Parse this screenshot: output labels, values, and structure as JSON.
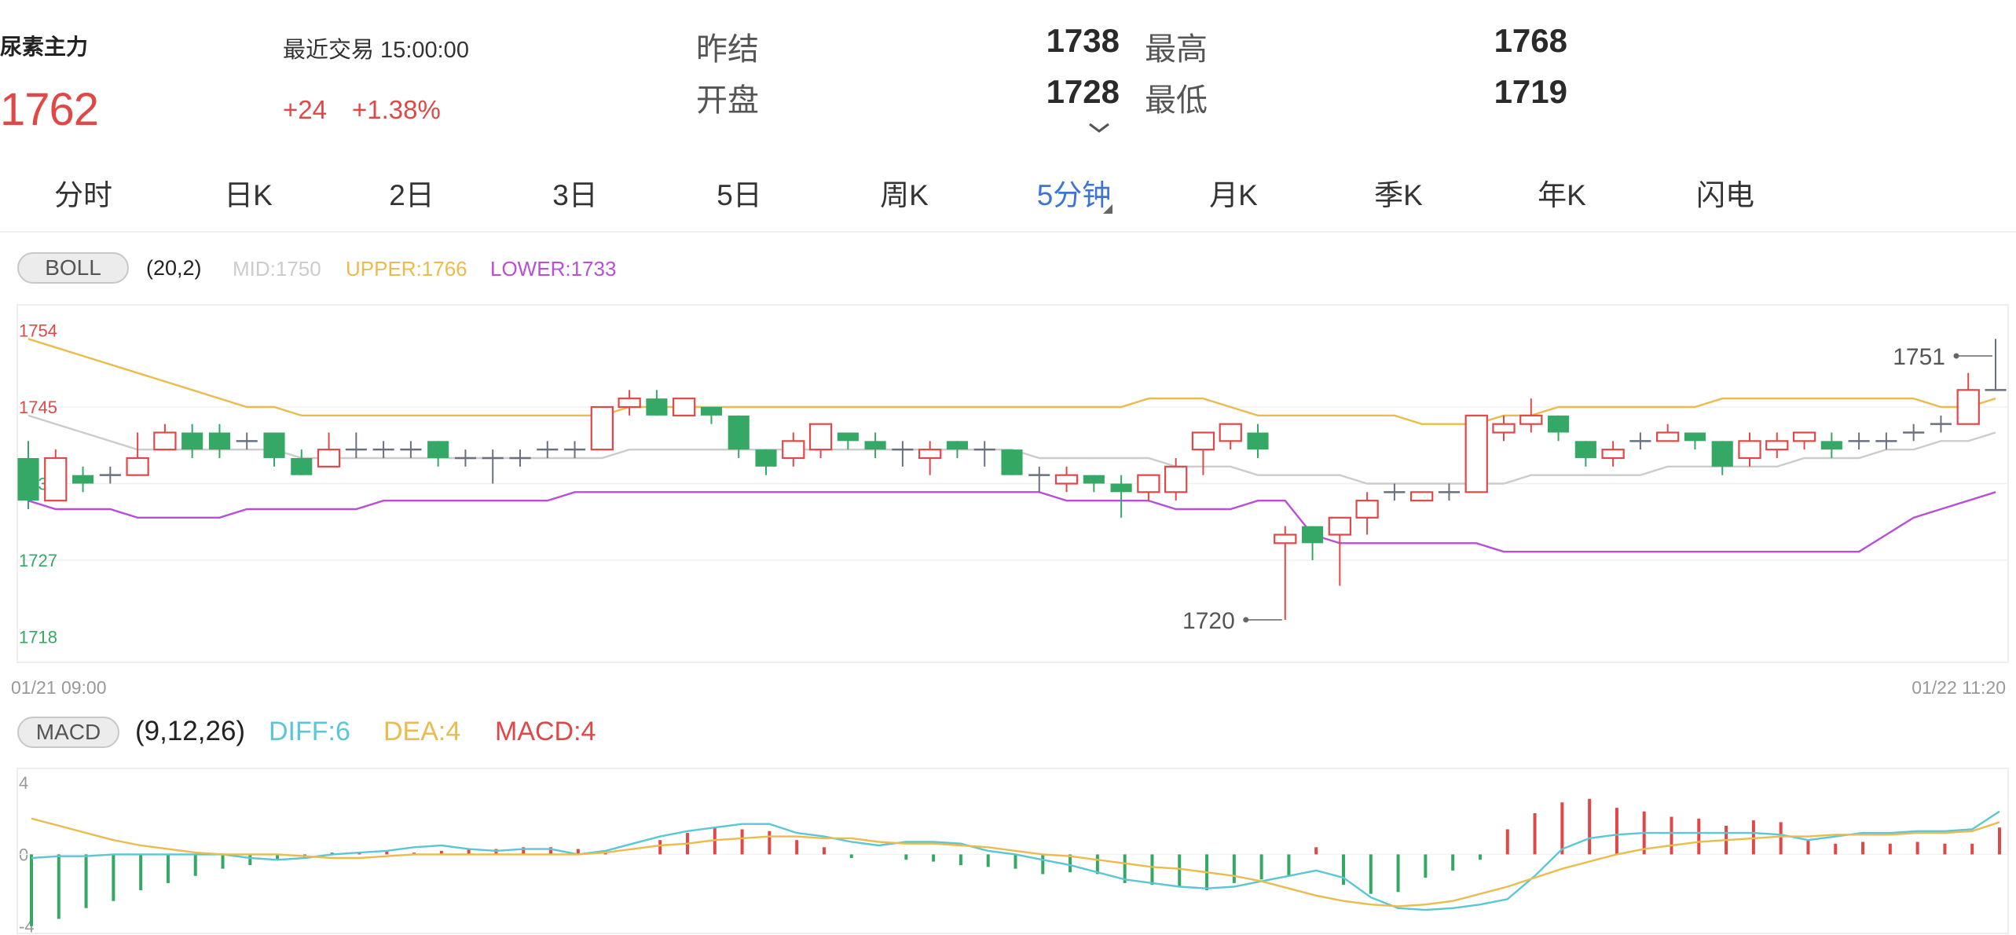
{
  "header": {
    "symbol_name": "尿素主力",
    "last_price": "1762",
    "last_trade_label": "最近交易 15:00:00",
    "change": "+24",
    "change_pct": "+1.38%",
    "stats": {
      "prev_settle_label": "昨结",
      "prev_settle_value": "1738",
      "high_label": "最高",
      "high_value": "1768",
      "open_label": "开盘",
      "open_value": "1728",
      "low_label": "最低",
      "low_value": "1719"
    }
  },
  "tabs": [
    {
      "label": "分时",
      "active": false
    },
    {
      "label": "日K",
      "active": false
    },
    {
      "label": "2日",
      "active": false
    },
    {
      "label": "3日",
      "active": false
    },
    {
      "label": "5日",
      "active": false
    },
    {
      "label": "周K",
      "active": false
    },
    {
      "label": "5分钟",
      "active": true
    },
    {
      "label": "月K",
      "active": false
    },
    {
      "label": "季K",
      "active": false
    },
    {
      "label": "年K",
      "active": false
    },
    {
      "label": "闪电",
      "active": false
    }
  ],
  "boll": {
    "name": "BOLL",
    "params": "(20,2)",
    "mid": "MID:1750",
    "upper": "UPPER:1766",
    "lower": "LOWER:1733"
  },
  "macd": {
    "name": "MACD",
    "params": "(9,12,26)",
    "diff": "DIFF:6",
    "dea": "DEA:4",
    "macd": "MACD:4"
  },
  "colors": {
    "up": "#e04848",
    "down": "#35a865",
    "flat": "#6a7080",
    "mid": "#cccccc",
    "upper": "#ebbb4e",
    "lower": "#b84fd8",
    "diff": "#5bc6d6",
    "dea": "#ebbb4e",
    "macd_label": "#e04848",
    "active_tab": "#3d74d6"
  },
  "chart_data": [
    {
      "type": "candlestick",
      "title": "BOLL",
      "y_ticks": [
        1754,
        1745,
        1736,
        1727,
        1718
      ],
      "ylim": [
        1715,
        1757
      ],
      "x_start_label": "01/21 09:00",
      "x_end_label": "01/22 11:20",
      "annotations": [
        {
          "text": "1751",
          "value": 1751
        },
        {
          "text": "1720",
          "value": 1720
        }
      ],
      "candles": [
        [
          1739,
          1734,
          1741,
          1733
        ],
        [
          1734,
          1739,
          1740,
          1734
        ],
        [
          1737,
          1736,
          1738,
          1735
        ],
        [
          1737,
          1737,
          1738,
          1736
        ],
        [
          1737,
          1739,
          1742,
          1737
        ],
        [
          1740,
          1742,
          1743,
          1740
        ],
        [
          1742,
          1740,
          1743,
          1739
        ],
        [
          1742,
          1740,
          1743,
          1739
        ],
        [
          1741,
          1741,
          1742,
          1740
        ],
        [
          1742,
          1739,
          1742,
          1738
        ],
        [
          1739,
          1737,
          1740,
          1737
        ],
        [
          1738,
          1740,
          1742,
          1738
        ],
        [
          1740,
          1740,
          1742,
          1739
        ],
        [
          1740,
          1740,
          1741,
          1739
        ],
        [
          1740,
          1740,
          1741,
          1739
        ],
        [
          1741,
          1739,
          1741,
          1738
        ],
        [
          1739,
          1739,
          1740,
          1738
        ],
        [
          1739,
          1739,
          1740,
          1736
        ],
        [
          1739,
          1739,
          1740,
          1738
        ],
        [
          1740,
          1740,
          1741,
          1739
        ],
        [
          1740,
          1740,
          1741,
          1739
        ],
        [
          1740,
          1745,
          1745,
          1740
        ],
        [
          1745,
          1746,
          1747,
          1744
        ],
        [
          1746,
          1744,
          1747,
          1744
        ],
        [
          1744,
          1746,
          1746,
          1744
        ],
        [
          1745,
          1744,
          1745,
          1743
        ],
        [
          1744,
          1740,
          1744,
          1739
        ],
        [
          1740,
          1738,
          1740,
          1737
        ],
        [
          1739,
          1741,
          1742,
          1738
        ],
        [
          1740,
          1743,
          1743,
          1739
        ],
        [
          1742,
          1741,
          1742,
          1740
        ],
        [
          1741,
          1740,
          1742,
          1739
        ],
        [
          1740,
          1740,
          1741,
          1738
        ],
        [
          1739,
          1740,
          1741,
          1737
        ],
        [
          1741,
          1740,
          1741,
          1739
        ],
        [
          1740,
          1740,
          1741,
          1738
        ],
        [
          1740,
          1737,
          1740,
          1737
        ],
        [
          1737,
          1737,
          1738,
          1735
        ],
        [
          1736,
          1737,
          1738,
          1735
        ],
        [
          1737,
          1736,
          1737,
          1735
        ],
        [
          1736,
          1735,
          1737,
          1732
        ],
        [
          1735,
          1737,
          1737,
          1734
        ],
        [
          1735,
          1738,
          1739,
          1734
        ],
        [
          1740,
          1742,
          1742,
          1737
        ],
        [
          1741,
          1743,
          1743,
          1740
        ],
        [
          1742,
          1740,
          1743,
          1739
        ],
        [
          1729,
          1730,
          1731,
          1720
        ],
        [
          1731,
          1729,
          1731,
          1727
        ],
        [
          1730,
          1732,
          1732,
          1724
        ],
        [
          1732,
          1734,
          1735,
          1730
        ],
        [
          1735,
          1735,
          1736,
          1734
        ],
        [
          1734,
          1735,
          1735,
          1734
        ],
        [
          1735,
          1735,
          1736,
          1734
        ],
        [
          1735,
          1744,
          1744,
          1735
        ],
        [
          1742,
          1743,
          1744,
          1741
        ],
        [
          1743,
          1744,
          1746,
          1742
        ],
        [
          1744,
          1742,
          1744,
          1741
        ],
        [
          1741,
          1739,
          1741,
          1738
        ],
        [
          1739,
          1740,
          1741,
          1738
        ],
        [
          1741,
          1741,
          1742,
          1740
        ],
        [
          1741,
          1742,
          1743,
          1741
        ],
        [
          1742,
          1741,
          1742,
          1740
        ],
        [
          1741,
          1738,
          1741,
          1737
        ],
        [
          1739,
          1741,
          1742,
          1738
        ],
        [
          1740,
          1741,
          1742,
          1739
        ],
        [
          1741,
          1742,
          1742,
          1740
        ],
        [
          1741,
          1740,
          1742,
          1739
        ],
        [
          1741,
          1741,
          1742,
          1740
        ],
        [
          1741,
          1741,
          1742,
          1740
        ],
        [
          1742,
          1742,
          1743,
          1741
        ],
        [
          1743,
          1743,
          1744,
          1742
        ],
        [
          1743,
          1747,
          1749,
          1743
        ],
        [
          1747,
          1747,
          1753,
          1747
        ]
      ],
      "series": [
        {
          "name": "MID",
          "values": [
            1744,
            1743,
            1742,
            1741,
            1740,
            1740,
            1740,
            1740,
            1740,
            1740,
            1739,
            1739,
            1739,
            1739,
            1739,
            1739,
            1739,
            1739,
            1739,
            1739,
            1739,
            1739,
            1740,
            1740,
            1740,
            1740,
            1740,
            1740,
            1740,
            1740,
            1740,
            1740,
            1740,
            1740,
            1740,
            1740,
            1740,
            1739,
            1739,
            1739,
            1739,
            1739,
            1738,
            1738,
            1738,
            1737,
            1737,
            1737,
            1737,
            1736,
            1736,
            1736,
            1736,
            1736,
            1736,
            1737,
            1737,
            1737,
            1737,
            1737,
            1738,
            1738,
            1738,
            1738,
            1738,
            1739,
            1739,
            1739,
            1740,
            1740,
            1741,
            1741,
            1742
          ]
        },
        {
          "name": "UPPER",
          "values": [
            1753,
            1752,
            1751,
            1750,
            1749,
            1748,
            1747,
            1746,
            1745,
            1745,
            1744,
            1744,
            1744,
            1744,
            1744,
            1744,
            1744,
            1744,
            1744,
            1744,
            1744,
            1744,
            1745,
            1745,
            1745,
            1745,
            1745,
            1745,
            1745,
            1745,
            1745,
            1745,
            1745,
            1745,
            1745,
            1745,
            1745,
            1745,
            1745,
            1745,
            1745,
            1746,
            1746,
            1746,
            1745,
            1744,
            1744,
            1744,
            1744,
            1744,
            1744,
            1743,
            1743,
            1743,
            1744,
            1744,
            1745,
            1745,
            1745,
            1745,
            1745,
            1745,
            1746,
            1746,
            1746,
            1746,
            1746,
            1746,
            1746,
            1746,
            1745,
            1745,
            1746
          ]
        },
        {
          "name": "LOWER",
          "values": [
            1734,
            1733,
            1733,
            1733,
            1732,
            1732,
            1732,
            1732,
            1733,
            1733,
            1733,
            1733,
            1733,
            1734,
            1734,
            1734,
            1734,
            1734,
            1734,
            1734,
            1735,
            1735,
            1735,
            1735,
            1735,
            1735,
            1735,
            1735,
            1735,
            1735,
            1735,
            1735,
            1735,
            1735,
            1735,
            1735,
            1735,
            1735,
            1734,
            1734,
            1734,
            1734,
            1733,
            1733,
            1733,
            1734,
            1734,
            1730,
            1729,
            1729,
            1729,
            1729,
            1729,
            1729,
            1728,
            1728,
            1728,
            1728,
            1728,
            1728,
            1728,
            1728,
            1728,
            1728,
            1728,
            1728,
            1728,
            1728,
            1730,
            1732,
            1733,
            1734,
            1735
          ]
        }
      ]
    },
    {
      "type": "bar",
      "title": "MACD",
      "y_ticks": [
        4,
        0,
        -4
      ],
      "ylim": [
        -4.5,
        4.8
      ],
      "series": [
        {
          "name": "MACD",
          "values": [
            -4,
            -3.6,
            -3.0,
            -2.6,
            -2.0,
            -1.6,
            -1.2,
            -0.8,
            -0.6,
            -0.3,
            -0.2,
            0.1,
            0.1,
            0.2,
            0.1,
            0.2,
            0.3,
            0.3,
            0.4,
            0.4,
            0.3,
            0.2,
            0,
            0.8,
            1.2,
            1.5,
            1.4,
            1.3,
            0.8,
            0.4,
            -0.2,
            0,
            -0.3,
            -0.4,
            -0.6,
            -0.7,
            -0.8,
            -1.1,
            -1.0,
            -1.1,
            -1.6,
            -1.7,
            -1.8,
            -2.0,
            -1.6,
            -1.4,
            -1.2,
            0.4,
            -1.7,
            -2.2,
            -2.1,
            -1.3,
            -0.9,
            -0.3,
            1.4,
            2.3,
            2.9,
            3.1,
            2.6,
            2.4,
            2.1,
            2.0,
            1.6,
            1.9,
            1.8,
            0.8,
            0.6,
            0.7,
            0.6,
            0.7,
            0.6,
            0.6,
            1.5
          ]
        },
        {
          "name": "DIFF",
          "values": [
            -0.2,
            -0.1,
            -0.1,
            0,
            0,
            0,
            0,
            0,
            -0.2,
            -0.3,
            -0.2,
            0,
            0.1,
            0.2,
            0.4,
            0.5,
            0.3,
            0.2,
            0.3,
            0.3,
            0,
            0.2,
            0.6,
            1,
            1.3,
            1.5,
            1.7,
            1.7,
            1.2,
            1.0,
            0.7,
            0.5,
            0.7,
            0.7,
            0.6,
            0.2,
            0,
            -0.3,
            -0.6,
            -1,
            -1.4,
            -1.6,
            -1.8,
            -1.9,
            -1.8,
            -1.5,
            -1.2,
            -0.9,
            -1.3,
            -2.4,
            -3.0,
            -3.1,
            -3.0,
            -2.8,
            -2.5,
            -1.2,
            0.3,
            0.9,
            1.1,
            1.2,
            1.2,
            1.2,
            1.2,
            1.2,
            1.1,
            0.8,
            1.0,
            1.2,
            1.2,
            1.3,
            1.3,
            1.4,
            2.4
          ]
        },
        {
          "name": "DEA",
          "values": [
            2.0,
            1.6,
            1.2,
            0.8,
            0.5,
            0.3,
            0.1,
            0,
            0,
            0,
            -0.1,
            -0.2,
            -0.2,
            -0.1,
            0,
            0,
            0,
            0,
            0,
            0,
            0,
            0.1,
            0.3,
            0.5,
            0.6,
            0.8,
            0.9,
            1.0,
            1.0,
            0.9,
            0.9,
            0.7,
            0.6,
            0.6,
            0.5,
            0.4,
            0.2,
            0,
            -0.1,
            -0.3,
            -0.5,
            -0.7,
            -0.8,
            -1.0,
            -1.2,
            -1.5,
            -1.9,
            -2.3,
            -2.6,
            -2.8,
            -2.9,
            -2.8,
            -2.6,
            -2.2,
            -1.8,
            -1.3,
            -0.8,
            -0.4,
            0,
            0.3,
            0.5,
            0.7,
            0.8,
            0.9,
            1.0,
            1.0,
            1.1,
            1.1,
            1.1,
            1.2,
            1.2,
            1.3,
            1.8
          ]
        }
      ]
    }
  ]
}
